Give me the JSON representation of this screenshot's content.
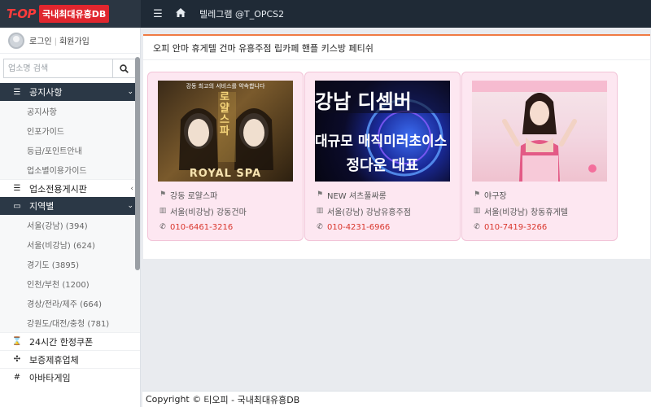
{
  "header": {
    "logo_text": "T-OP",
    "logo_badge": "국내최대유흥DB",
    "title": "텔레그램 @T_OPCS2"
  },
  "sidebar": {
    "login": "로그인",
    "signup": "회원가입",
    "search_placeholder": "업소명 검색",
    "sections": [
      {
        "label": "공지사항",
        "subs": [
          "공지사항",
          "인포가이드",
          "등급/포인트안내",
          "업소별이용가이드"
        ]
      },
      {
        "label": "업소전용게시판"
      },
      {
        "label": "지역별",
        "subs": [
          "서울(강남) (394)",
          "서울(비강남) (624)",
          "경기도 (3895)",
          "인천/부천 (1200)",
          "경상/전라/제주 (664)",
          "강원도/대전/충청 (781)"
        ]
      }
    ],
    "items": [
      "24시간 한정쿠폰",
      "보증제휴업체",
      "아바타게임"
    ]
  },
  "main": {
    "panel_title": "오피 안마 휴게텔 건마 유흥주점 립카페 핸플 키스방 페티쉬",
    "cards": [
      {
        "thumb_top": "강동 최고의 서비스를 약속합니다",
        "thumb_side": "로얄스파",
        "thumb_caption": "ROYAL SPA",
        "name": "강동 로얄스파",
        "location": "서울(비강남) 강동건마",
        "phone": "010-6461-3216"
      },
      {
        "thumb_line1": "강남 디셈버",
        "thumb_line2": "대규모 매직미러초이스",
        "thumb_line3": "정다운 대표",
        "name": "NEW 셔츠풀싸롱",
        "location": "서울(강남) 강남유흥주점",
        "phone": "010-4231-6966"
      },
      {
        "name": "야구장",
        "location": "서울(비강남) 창동휴게텔",
        "phone": "010-7419-3266"
      }
    ]
  },
  "footer": {
    "prefix": "Copyright © ",
    "brand": "티오피 - 국내최대유흥DB"
  }
}
